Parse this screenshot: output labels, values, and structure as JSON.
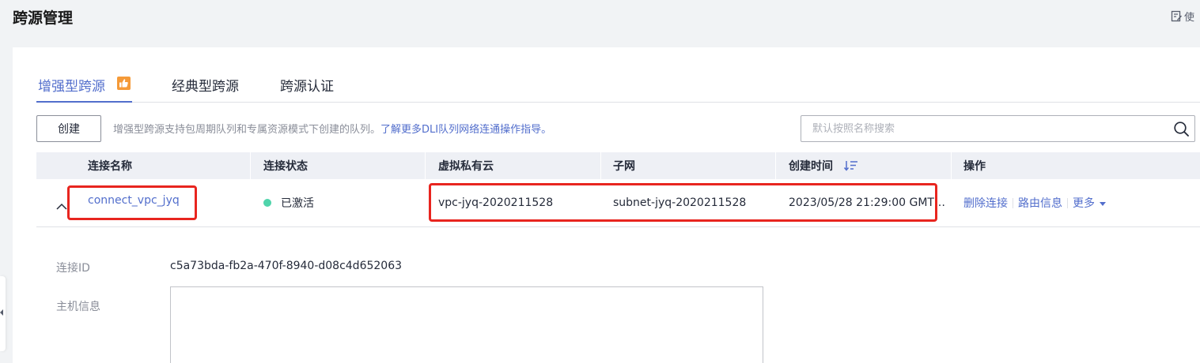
{
  "page": {
    "title": "跨源管理",
    "help_label": "使",
    "help_icon": "edit-note-icon"
  },
  "tabs": [
    {
      "label": "增强型跨源",
      "active": true,
      "badge_icon": "thumbs-up-icon",
      "badge_color": "#f59a38"
    },
    {
      "label": "经典型跨源",
      "active": false
    },
    {
      "label": "跨源认证",
      "active": false
    }
  ],
  "toolbar": {
    "create_label": "创建",
    "hint_text": "增强型跨源支持包周期队列和专属资源模式下创建的队列。",
    "hint_link": "了解更多DLI队列网络连通操作指导。",
    "search_placeholder": "默认按照名称搜索",
    "search_icon": "search-icon"
  },
  "table": {
    "columns": [
      "连接名称",
      "连接状态",
      "虚拟私有云",
      "子网",
      "创建时间",
      "操作"
    ],
    "sort_icon": "sort-descending-icon",
    "rows": [
      {
        "expanded": true,
        "name": "connect_vpc_jyq",
        "status": "已激活",
        "status_color": "#50d4ab",
        "vpc": "vpc-jyq-2020211528",
        "subnet": "subnet-jyq-2020211528",
        "created": "2023/05/28 21:29:00 GMT…",
        "actions": [
          "删除连接",
          "路由信息",
          "更多"
        ]
      }
    ]
  },
  "detail": {
    "id_label": "连接ID",
    "id_value": "c5a73bda-fb2a-470f-8940-d08c4d652063",
    "host_label": "主机信息",
    "host_value": ""
  },
  "colors": {
    "accent": "#526ecc",
    "highlight": "#e8251f",
    "header_bg": "#eef0f5"
  }
}
